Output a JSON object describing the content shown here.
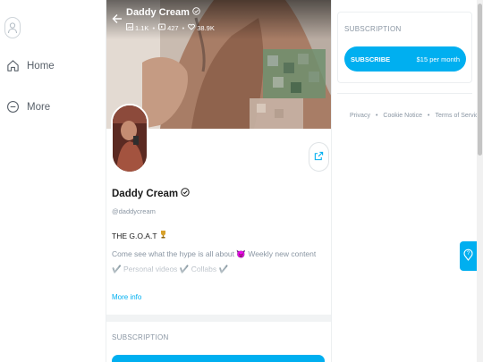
{
  "nav": {
    "home_label": "Home",
    "more_label": "More"
  },
  "cover": {
    "name": "Daddy Cream",
    "stats": {
      "photos": "1.1K",
      "videos": "427",
      "likes": "38.9K"
    }
  },
  "profile": {
    "name": "Daddy Cream",
    "handle": "@daddycream",
    "bio_title": "THE G.O.A.T",
    "bio_text": "Come see what the hype is all about 😈 Weekly new content ✔️ Personal videos ✔️ Collabs ✔️",
    "more_info": "More info"
  },
  "center_subscription": {
    "label": "SUBSCRIPTION"
  },
  "right_subscription": {
    "label": "SUBSCRIPTION",
    "button_label": "SUBSCRIBE",
    "price": "$15 per month"
  },
  "footer": {
    "privacy": "Privacy",
    "cookie": "Cookie Notice",
    "terms": "Terms of Service",
    "separator": "•"
  },
  "colors": {
    "accent": "#00aff0",
    "muted_text": "#8a96a3",
    "nav_text": "#59616a"
  },
  "icons": [
    "user-avatar-icon",
    "home-icon",
    "more-icon",
    "back-arrow-icon",
    "verified-icon",
    "image-icon",
    "video-icon",
    "heart-icon",
    "share-icon",
    "trophy-icon",
    "help-icon"
  ]
}
